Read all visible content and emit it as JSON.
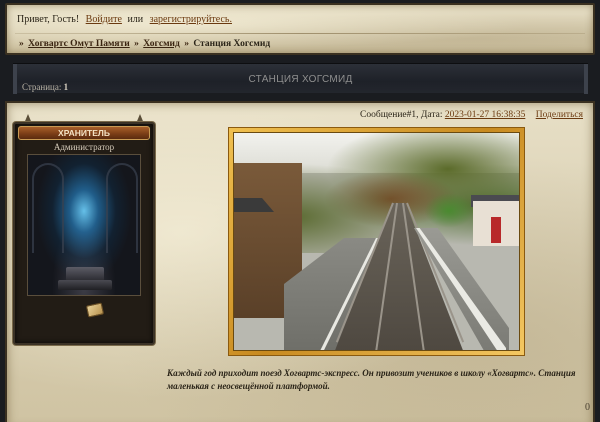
{
  "header": {
    "greeting": "Привет, Гость!",
    "login_link": "Войдите",
    "or_text": "или",
    "register_link": "зарегистрируйтесь."
  },
  "breadcrumb": {
    "prefix": "»",
    "items": [
      "Хогвартс Омут Памяти",
      "Хогсмид",
      "Станция Хогсмид"
    ],
    "separator": "»"
  },
  "topic": {
    "title": "СТАНЦИЯ ХОГСМИД",
    "pages_label": "Страница:",
    "pages_value": "1"
  },
  "post": {
    "meta_text": "Сообщение#1, Дата:",
    "date": "2023-01-27 16:38:35",
    "share_label": "Поделиться",
    "caption": "Каждый год приходит поезд Хогвартс-экспресс. Он привозит учеников в школу «Хогвартс». Станция маленькая с неосвещённой платформой.",
    "count": "0"
  },
  "profile": {
    "rank": "ХРАНИТЕЛЬ",
    "role": "Администратор"
  },
  "colors": {
    "link": "#6b3a10",
    "rank_bg": "#7c3e17",
    "title_bar": "#23262d",
    "photo_border": "#e0a838"
  }
}
